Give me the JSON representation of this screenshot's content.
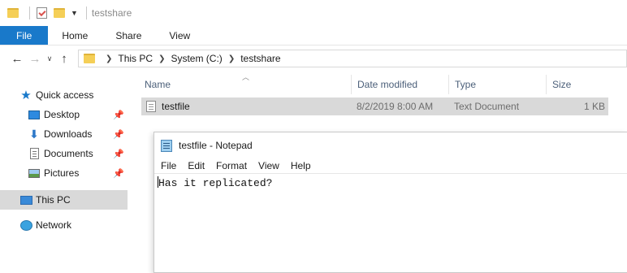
{
  "window": {
    "title": "testshare"
  },
  "ribbon": {
    "tabs": [
      "File",
      "Home",
      "Share",
      "View"
    ]
  },
  "address": {
    "crumbs": [
      "This PC",
      "System (C:)",
      "testshare"
    ]
  },
  "navpane": {
    "quick_access": "Quick access",
    "items": [
      {
        "label": "Desktop",
        "icon": "desktop-icon",
        "pinned": true
      },
      {
        "label": "Downloads",
        "icon": "downloads-icon",
        "pinned": true
      },
      {
        "label": "Documents",
        "icon": "documents-icon",
        "pinned": true
      },
      {
        "label": "Pictures",
        "icon": "pictures-icon",
        "pinned": true
      }
    ],
    "this_pc": "This PC",
    "network": "Network"
  },
  "filelist": {
    "columns": [
      "Name",
      "Date modified",
      "Type",
      "Size"
    ],
    "rows": [
      {
        "name": "testfile",
        "date_modified": "8/2/2019 8:00 AM",
        "type": "Text Document",
        "size": "1 KB"
      }
    ]
  },
  "notepad": {
    "title": "testfile - Notepad",
    "menu": [
      "File",
      "Edit",
      "Format",
      "View",
      "Help"
    ],
    "content": "Has it replicated?"
  },
  "colors": {
    "accent": "#1979ca",
    "selection": "#d9d9d9",
    "header_text": "#4c607a"
  }
}
